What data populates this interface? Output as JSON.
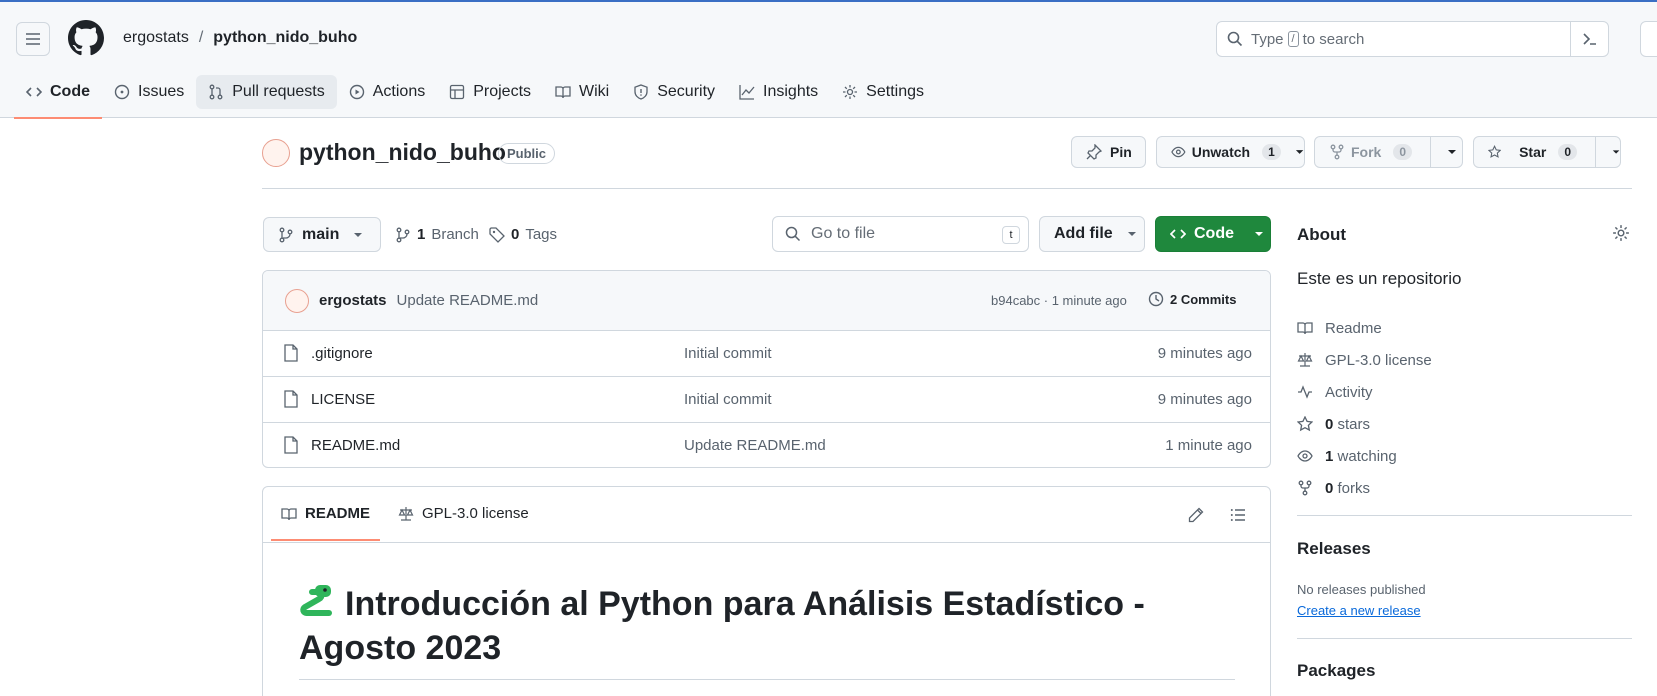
{
  "breadcrumb": {
    "owner": "ergostats",
    "separator": "/",
    "repo": "python_nido_buho"
  },
  "search": {
    "prefix": "Type",
    "key": "/",
    "suffix": "to search"
  },
  "nav": [
    {
      "label": "Code",
      "icon": "code-icon"
    },
    {
      "label": "Issues",
      "icon": "issue-icon"
    },
    {
      "label": "Pull requests",
      "icon": "pull-request-icon"
    },
    {
      "label": "Actions",
      "icon": "play-icon"
    },
    {
      "label": "Projects",
      "icon": "table-icon"
    },
    {
      "label": "Wiki",
      "icon": "book-icon"
    },
    {
      "label": "Security",
      "icon": "shield-icon"
    },
    {
      "label": "Insights",
      "icon": "graph-icon"
    },
    {
      "label": "Settings",
      "icon": "gear-icon"
    }
  ],
  "repo": {
    "name": "python_nido_buho",
    "visibility": "Public",
    "pin_label": "Pin",
    "unwatch_label": "Unwatch",
    "watch_count": "1",
    "fork_label": "Fork",
    "fork_count": "0",
    "star_label": "Star",
    "star_count": "0"
  },
  "toolbar": {
    "branch": "main",
    "branch_count": "1",
    "branch_label": "Branch",
    "tag_count": "0",
    "tag_label": "Tags",
    "go_to_file": "Go to file",
    "go_to_file_key": "t",
    "add_file": "Add file",
    "code": "Code"
  },
  "latest_commit": {
    "author": "ergostats",
    "message": "Update README.md",
    "hash_time": "b94cabc · 1 minute ago",
    "commits": "2 Commits"
  },
  "files": [
    {
      "name": ".gitignore",
      "message": "Initial commit",
      "age": "9 minutes ago"
    },
    {
      "name": "LICENSE",
      "message": "Initial commit",
      "age": "9 minutes ago"
    },
    {
      "name": "README.md",
      "message": "Update README.md",
      "age": "1 minute ago"
    }
  ],
  "readme": {
    "tab_readme": "README",
    "tab_license": "GPL-3.0 license",
    "heading_line1": "Introducción al Python para Análisis Estadístico -",
    "heading_line2": "Agosto 2023"
  },
  "about": {
    "title": "About",
    "description": "Este es un repositorio",
    "readme": "Readme",
    "license": "GPL-3.0 license",
    "activity": "Activity",
    "stars_count": "0",
    "stars_label": "stars",
    "watching_count": "1",
    "watching_label": "watching",
    "forks_count": "0",
    "forks_label": "forks"
  },
  "releases": {
    "title": "Releases",
    "note": "No releases published",
    "link": "Create a new release"
  },
  "packages": {
    "title": "Packages"
  },
  "colors": {
    "accent": "#fd8c73",
    "primary_button": "#1f883d",
    "link": "#0969da"
  }
}
